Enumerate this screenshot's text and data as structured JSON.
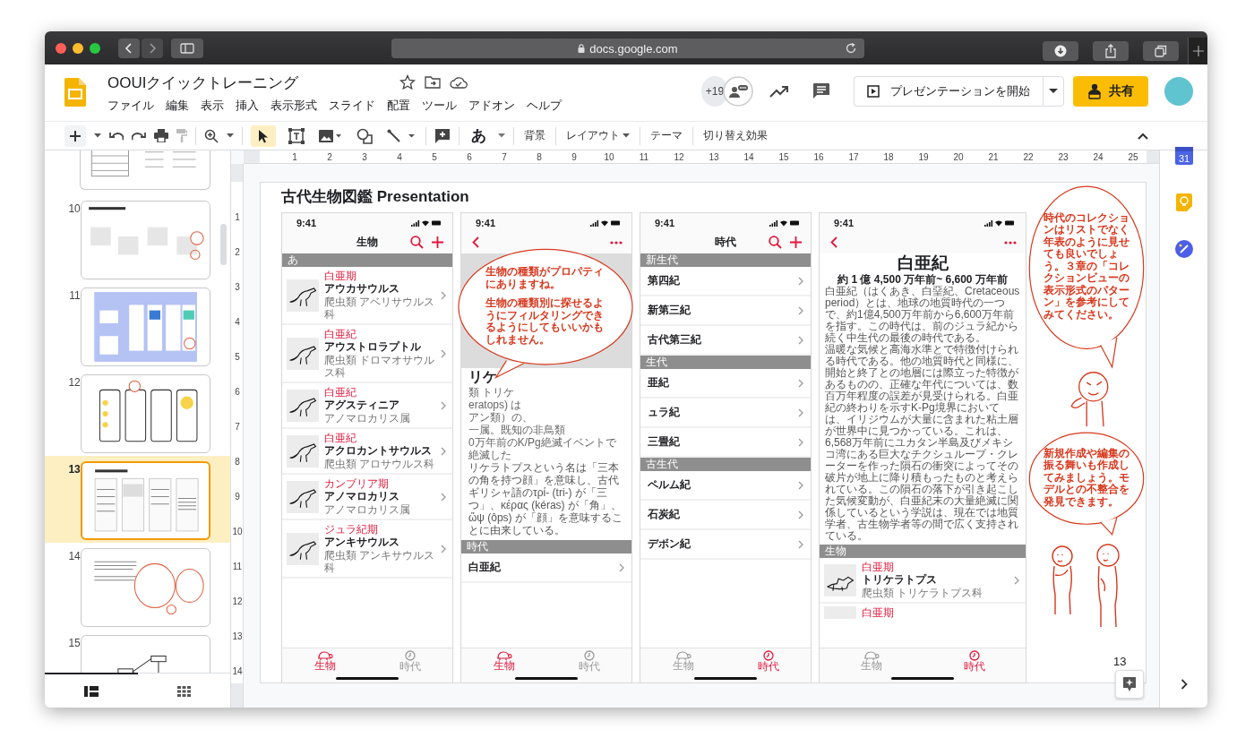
{
  "browser": {
    "url": "docs.google.com"
  },
  "document": {
    "title": "OOUIクイックトレーニング",
    "menu": [
      "ファイル",
      "編集",
      "表示",
      "挿入",
      "表示形式",
      "スライド",
      "配置",
      "ツール",
      "アドオン",
      "ヘルプ"
    ],
    "collaborators": "+19",
    "present": "プレゼンテーションを開始",
    "share": "共有"
  },
  "toolbar": {
    "tools": [
      {
        "kind": "select",
        "selected": true
      },
      {
        "kind": "textbox",
        "selected": false
      },
      {
        "kind": "image",
        "selected": false
      },
      {
        "kind": "shape",
        "selected": false
      },
      {
        "kind": "line",
        "selected": false
      }
    ],
    "font": "あ",
    "items": [
      {
        "kind": "button",
        "label": "背景"
      },
      {
        "kind": "menu",
        "label": "レイアウト"
      },
      {
        "kind": "button",
        "label": "テーマ"
      },
      {
        "kind": "button",
        "label": "切り替え効果"
      }
    ]
  },
  "ruler": {
    "horizontal": [
      "1",
      "2",
      "3",
      "4",
      "5",
      "6",
      "7",
      "8",
      "9",
      "10",
      "11",
      "12",
      "13",
      "14",
      "15",
      "16",
      "17",
      "18",
      "19",
      "20",
      "21",
      "22",
      "23",
      "24",
      "25"
    ],
    "vertical": [
      "1",
      "2",
      "3",
      "4",
      "5",
      "6",
      "7",
      "8",
      "9",
      "10",
      "11",
      "12",
      "13",
      "14"
    ]
  },
  "filmstrip": {
    "slides": [
      {
        "kind": "tables",
        "selected": false
      },
      {
        "number": "10",
        "kind": "boxes",
        "selected": false
      },
      {
        "number": "11",
        "kind": "diagram",
        "selected": false
      },
      {
        "number": "12",
        "kind": "sketch",
        "selected": false
      },
      {
        "number": "13",
        "kind": "phones",
        "selected": true
      },
      {
        "number": "14",
        "kind": "bubbles",
        "selected": false
      },
      {
        "number": "15",
        "kind": "flow",
        "selected": false
      }
    ],
    "views": [
      {
        "kind": "list",
        "selected": true
      },
      {
        "kind": "grid",
        "selected": false
      }
    ]
  },
  "slide": {
    "title": "古代生物図鑑 Presentation",
    "page_number": "13",
    "phones": [
      {
        "kind": "creature-list",
        "time": "9:41",
        "title": "生物",
        "section": "あ",
        "rows": [
          {
            "era": "白亜期",
            "name": "アウカサウルス",
            "family": "爬虫類 アベリサウルス科"
          },
          {
            "era": "白亜紀",
            "name": "アウストロラプトル",
            "family": "爬虫類 ドロマオサウルス科"
          },
          {
            "era": "白亜紀",
            "name": "アグスティニア",
            "family": "アノマロカリス属"
          },
          {
            "era": "白亜紀",
            "name": "アクロカントサウルス",
            "family": "爬虫類 アロサウルス科"
          },
          {
            "era": "カンブリア期",
            "name": "アノマロカリス",
            "family": "アノマロカリス属"
          },
          {
            "era": "ジュラ紀期",
            "name": "アンキサウルス",
            "family": "爬虫類 アンキサウルス科"
          }
        ],
        "tabs": [
          {
            "kind": "creature",
            "label": "生物",
            "selected": true
          },
          {
            "kind": "era",
            "label": "時代",
            "selected": false
          }
        ]
      },
      {
        "kind": "creature-detail",
        "time": "9:41",
        "title": "リケ",
        "subtitle": "類 トリケ",
        "fragments": [
          "eratops) は",
          "アン類）の、",
          "一属。既知の非鳥類",
          "0万年前のK/Pg絶滅イベントで絶滅した"
        ],
        "text": "リケラトプスという名は「三本の角を持つ顔」を意味し、古代ギリシャ語のτρί- (tri-) が「三つ」、κέρας (kéras) が「角」、ὤψ (ôps) が「顔」を意味することに由来している。",
        "section": "時代",
        "rows": [
          {
            "name": "白亜紀"
          }
        ],
        "tabs": [
          {
            "kind": "creature",
            "label": "生物",
            "selected": true
          },
          {
            "kind": "era",
            "label": "時代",
            "selected": false
          }
        ]
      },
      {
        "kind": "era-list",
        "time": "9:41",
        "title": "時代",
        "groups": [
          {
            "header": "新生代",
            "rows": [
              "第四紀",
              "新第三紀",
              "古代第三紀"
            ]
          },
          {
            "header": "生代",
            "rows": [
              "亜紀",
              "ュラ紀",
              "三畳紀"
            ]
          },
          {
            "header": "古生代",
            "rows": [
              "ペルム紀",
              "石炭紀",
              "デボン紀"
            ]
          }
        ],
        "tabs": [
          {
            "kind": "creature",
            "label": "生物",
            "selected": false
          },
          {
            "kind": "era",
            "label": "時代",
            "selected": true
          }
        ]
      },
      {
        "kind": "era-detail",
        "time": "9:41",
        "title": "白亜紀",
        "range": "約 1 億 4,500 万年前~ 6,600 万年前",
        "paragraphs": [
          "白亜紀（はくあき、白堊紀、Cretaceous period）とは、地球の地質時代の一つで、約1億4,500万年前から6,600万年前を指す。この時代は、前のジュラ紀から続く中生代の最後の時代である。",
          "温暖な気候と高海水準とで特徴付けられる時代である。他の地質時代と同様に、開始と終了との地層には際立った特徴があるものの、正確な年代については、数百万年程度の誤差が見受けられる。白亜紀の終わりを示すK-Pg境界においては、イリジウムが大量に含まれた粘土層が世界中に見つかっている。これは、6,568万年前にユカタン半島及びメキシコ湾にある巨大なチクシュループ・クレーターを作った隕石の衝突によってその破片が地上に降り積もったものと考えられている。この隕石の落下が引き起こした気候変動が、白亜紀末の大量絶滅に関係しているという学説は、現在では地質学者、古生物学者等の間で広く支持されている。"
        ],
        "section": "生物",
        "rows": [
          {
            "era": "白亜期",
            "name": "トリケラトプス",
            "family": "爬虫類 トリケラトプス科"
          },
          {
            "era": "白亜期"
          }
        ],
        "tabs": [
          {
            "kind": "creature",
            "label": "生物",
            "selected": false
          },
          {
            "kind": "era",
            "label": "時代",
            "selected": true
          }
        ]
      }
    ],
    "bubbles": [
      {
        "paragraphs": [
          "生物の種類がプロパティにありますね。",
          "生物の種類別に探せるようにフィルタリングできるようにしてもいいかもしれません。"
        ]
      },
      {
        "paragraphs": [
          "時代のコレクションはリストでなく年表のように見せても良いでしょう。３章の「コレクションビューの表示形式のパターン」を参考にしてみてください。"
        ]
      },
      {
        "paragraphs": [
          "新規作成や編集の振る舞いも作成してみましょう。モデルとの不整合を発見できます。"
        ]
      }
    ]
  },
  "side_panel": {
    "calendar": "31"
  }
}
